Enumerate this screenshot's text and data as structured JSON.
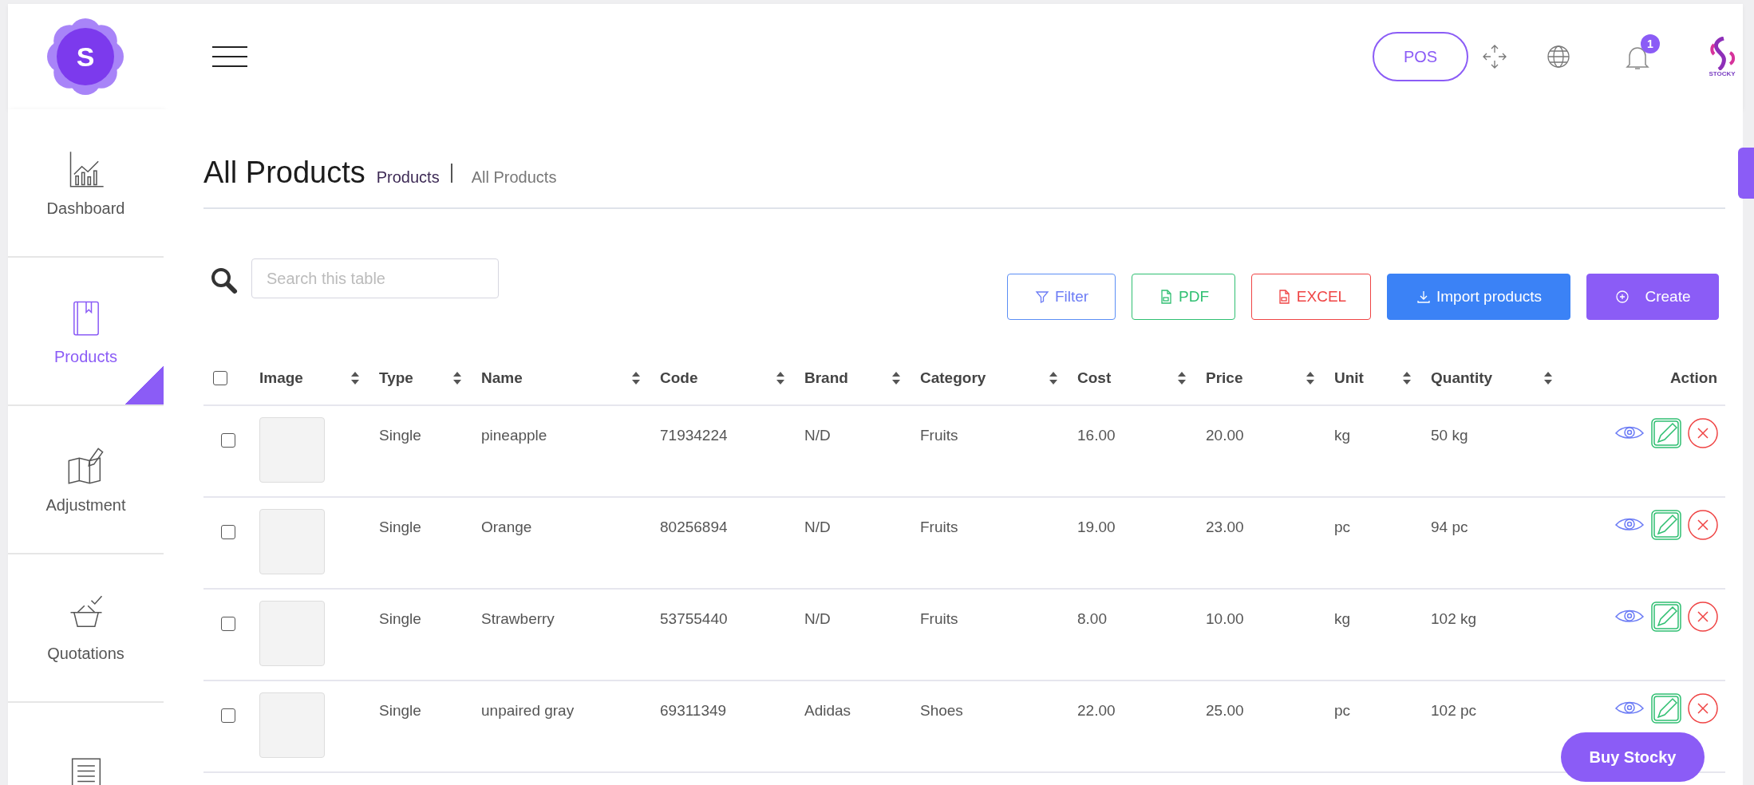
{
  "logo": {
    "letter": "S"
  },
  "header": {
    "pos_button": "POS",
    "notification_count": "1",
    "brand_caption": "STOCKY"
  },
  "sidebar": {
    "items": [
      {
        "label": "Dashboard",
        "kind": "chart",
        "selected": false
      },
      {
        "label": "Products",
        "kind": "book",
        "selected": true
      },
      {
        "label": "Adjustment",
        "kind": "map",
        "selected": false
      },
      {
        "label": "Quotations",
        "kind": "basket",
        "selected": false
      },
      {
        "kind": "receipt",
        "selected": false
      }
    ]
  },
  "page": {
    "title": "All Products",
    "breadcrumb": [
      "Products",
      "All Products"
    ]
  },
  "search": {
    "placeholder": "Search this table"
  },
  "buttons": [
    {
      "label": "Filter",
      "kind": "filter"
    },
    {
      "label": "PDF",
      "kind": "pdf"
    },
    {
      "label": "EXCEL",
      "kind": "excel"
    },
    {
      "label": "Import products",
      "kind": "import"
    },
    {
      "label": "Create",
      "kind": "create"
    }
  ],
  "table": {
    "select_all_checked": false,
    "columns": [
      {
        "label": "Image",
        "sortable": true
      },
      {
        "label": "Type",
        "sortable": true
      },
      {
        "label": "Name",
        "sortable": true
      },
      {
        "label": "Code",
        "sortable": true
      },
      {
        "label": "Brand",
        "sortable": true
      },
      {
        "label": "Category",
        "sortable": true
      },
      {
        "label": "Cost",
        "sortable": true
      },
      {
        "label": "Price",
        "sortable": true
      },
      {
        "label": "Unit",
        "sortable": true
      },
      {
        "label": "Quantity",
        "sortable": true
      },
      {
        "label": "Action",
        "sortable": false
      }
    ],
    "rows": [
      {
        "checked": false,
        "cells": [
          "",
          "Single",
          "pineapple",
          "71934224",
          "N/D",
          "Fruits",
          "16.00",
          "20.00",
          "kg",
          "50 kg"
        ]
      },
      {
        "checked": false,
        "cells": [
          "",
          "Single",
          "Orange",
          "80256894",
          "N/D",
          "Fruits",
          "19.00",
          "23.00",
          "pc",
          "94 pc"
        ]
      },
      {
        "checked": false,
        "cells": [
          "",
          "Single",
          "Strawberry",
          "53755440",
          "N/D",
          "Fruits",
          "8.00",
          "10.00",
          "kg",
          "102 kg"
        ]
      },
      {
        "checked": false,
        "cells": [
          "",
          "Single",
          "unpaired gray",
          "69311349",
          "Adidas",
          "Shoes",
          "22.00",
          "25.00",
          "pc",
          "102 pc"
        ]
      }
    ]
  },
  "floating_button": "Buy Stocky"
}
